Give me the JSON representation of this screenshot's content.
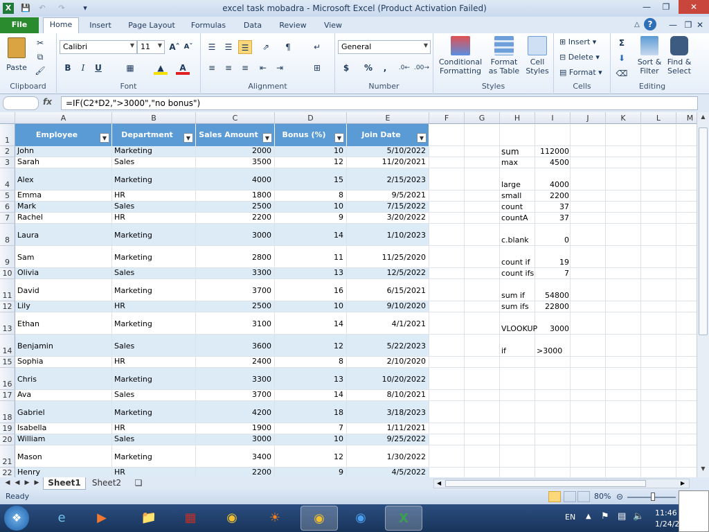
{
  "window": {
    "title": "excel task mobadra  -  Microsoft Excel (Product Activation Failed)"
  },
  "tabs": [
    "File",
    "Home",
    "Insert",
    "Page Layout",
    "Formulas",
    "Data",
    "Review",
    "View"
  ],
  "ribbon": {
    "clipboard": {
      "label": "Clipboard",
      "paste": "Paste"
    },
    "font": {
      "label": "Font",
      "name": "Calibri",
      "size": "11"
    },
    "alignment": {
      "label": "Alignment"
    },
    "number": {
      "label": "Number",
      "format": "General"
    },
    "styles": {
      "label": "Styles",
      "conditional1": "Conditional",
      "conditional2": "Formatting",
      "format_table1": "Format",
      "format_table2": "as Table",
      "cell_styles1": "Cell",
      "cell_styles2": "Styles"
    },
    "cells": {
      "label": "Cells",
      "insert": "Insert",
      "delete": "Delete",
      "format": "Format"
    },
    "editing": {
      "label": "Editing",
      "sort1": "Sort &",
      "sort2": "Filter",
      "find1": "Find &",
      "find2": "Select"
    }
  },
  "formula_bar": {
    "fx": "fx",
    "formula": "=IF(C2*D2,\">3000\",\"no bonus\")"
  },
  "columns": [
    "A",
    "B",
    "C",
    "D",
    "E",
    "F",
    "G",
    "H",
    "I",
    "J",
    "K",
    "L",
    "M"
  ],
  "table": {
    "headers": [
      "Employee",
      "Department",
      "Sales Amount",
      "Bonus (%)",
      "Join Date"
    ],
    "rows": [
      {
        "n": "2",
        "cells": [
          "John",
          "Marketing",
          "2000",
          "10",
          "5/10/2022"
        ]
      },
      {
        "n": "3",
        "cells": [
          "Sarah",
          "Sales",
          "3500",
          "12",
          "11/20/2021"
        ]
      },
      {
        "n": "4",
        "cells": [
          "Alex",
          "Marketing",
          "4000",
          "15",
          "2/15/2023"
        ]
      },
      {
        "n": "5",
        "cells": [
          "Emma",
          "HR",
          "1800",
          "8",
          "9/5/2021"
        ]
      },
      {
        "n": "6",
        "cells": [
          "Mark",
          "Sales",
          "2500",
          "10",
          "7/15/2022"
        ]
      },
      {
        "n": "7",
        "cells": [
          "Rachel",
          "HR",
          "2200",
          "9",
          "3/20/2022"
        ]
      },
      {
        "n": "8",
        "cells": [
          "Laura",
          "Marketing",
          "3000",
          "14",
          "1/10/2023"
        ]
      },
      {
        "n": "9",
        "cells": [
          "Sam",
          "Marketing",
          "2800",
          "11",
          "11/25/2020"
        ]
      },
      {
        "n": "10",
        "cells": [
          "Olivia",
          "Sales",
          "3300",
          "13",
          "12/5/2022"
        ]
      },
      {
        "n": "11",
        "cells": [
          "David",
          "Marketing",
          "3700",
          "16",
          "6/15/2021"
        ]
      },
      {
        "n": "12",
        "cells": [
          "Lily",
          "HR",
          "2500",
          "10",
          "9/10/2020"
        ]
      },
      {
        "n": "13",
        "cells": [
          "Ethan",
          "Marketing",
          "3100",
          "14",
          "4/1/2021"
        ]
      },
      {
        "n": "14",
        "cells": [
          "Benjamin",
          "Sales",
          "3600",
          "12",
          "5/22/2023"
        ]
      },
      {
        "n": "15",
        "cells": [
          "Sophia",
          "HR",
          "2400",
          "8",
          "2/10/2020"
        ]
      },
      {
        "n": "16",
        "cells": [
          "Chris",
          "Marketing",
          "3300",
          "13",
          "10/20/2022"
        ]
      },
      {
        "n": "17",
        "cells": [
          "Ava",
          "Sales",
          "3700",
          "14",
          "8/10/2021"
        ]
      },
      {
        "n": "18",
        "cells": [
          "Gabriel",
          "Marketing",
          "4200",
          "18",
          "3/18/2023"
        ]
      },
      {
        "n": "19",
        "cells": [
          "Isabella",
          "HR",
          "1900",
          "7",
          "1/11/2021"
        ]
      },
      {
        "n": "20",
        "cells": [
          "William",
          "Sales",
          "3000",
          "10",
          "9/25/2022"
        ]
      },
      {
        "n": "21",
        "cells": [
          "Mason",
          "Marketing",
          "3400",
          "12",
          "1/30/2022"
        ]
      },
      {
        "n": "22",
        "cells": [
          "Henry",
          "HR",
          "2200",
          "9",
          "4/5/2022"
        ]
      }
    ]
  },
  "summary": [
    {
      "row": "2",
      "label": "sum",
      "value": "112000"
    },
    {
      "row": "3",
      "label": "max",
      "value": "4500"
    },
    {
      "row": "4",
      "label": "large",
      "value": "4000"
    },
    {
      "row": "5",
      "label": "small",
      "value": "2200"
    },
    {
      "row": "6",
      "label": "count",
      "value": "37"
    },
    {
      "row": "7",
      "label": "countA",
      "value": "37"
    },
    {
      "row": "8",
      "label": "c.blank",
      "value": "0"
    },
    {
      "row": "9",
      "label": "count if",
      "value": "19"
    },
    {
      "row": "10",
      "label": "count ifs",
      "value": "7"
    },
    {
      "row": "11",
      "label": "sum if",
      "value": "54800"
    },
    {
      "row": "12",
      "label": "sum ifs",
      "value": "22800"
    },
    {
      "row": "13",
      "label": "VLOOKUP",
      "value": "3000"
    },
    {
      "row": "14",
      "label": "if",
      "value": ">3000"
    }
  ],
  "sheets": [
    "Sheet1",
    "Sheet2"
  ],
  "status": {
    "text": "Ready",
    "zoom": "80%"
  },
  "taskbar": {
    "lang": "EN",
    "time": "11:46",
    "date": "1/24/2"
  },
  "colors": {
    "table_header": "#5b9bd5",
    "band": "#ddebf7",
    "file_tab": "#2a8a2e"
  }
}
